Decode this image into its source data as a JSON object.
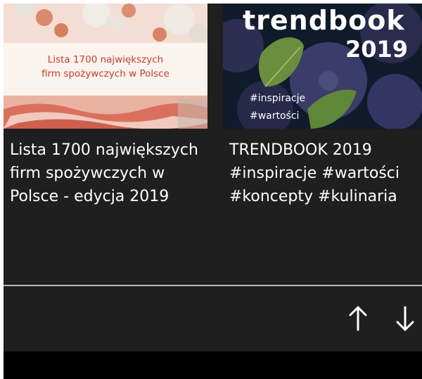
{
  "cards": [
    {
      "title": "Lista 1700 największych firm spożywczych w Polsce - edycja 2019",
      "thumbnail_text_line1": "Lista 1700 największych",
      "thumbnail_text_line2": "firm spożywczych w Polsce"
    },
    {
      "title": "TRENDBOOK 2019 #inspiracje #wartości #koncepty #kulinaria",
      "thumbnail_brand": "trendbook",
      "thumbnail_year": "2019",
      "thumbnail_tag1": "#inspiracje",
      "thumbnail_tag2": "#wartości"
    }
  ],
  "navigation": {
    "up_icon": "arrow-up-icon",
    "down_icon": "arrow-down-icon"
  },
  "colors": {
    "panel_bg": "#1f1f1f",
    "text": "#ffffff",
    "divider": "#b7b7b7",
    "accent_red": "#c13e2c"
  }
}
